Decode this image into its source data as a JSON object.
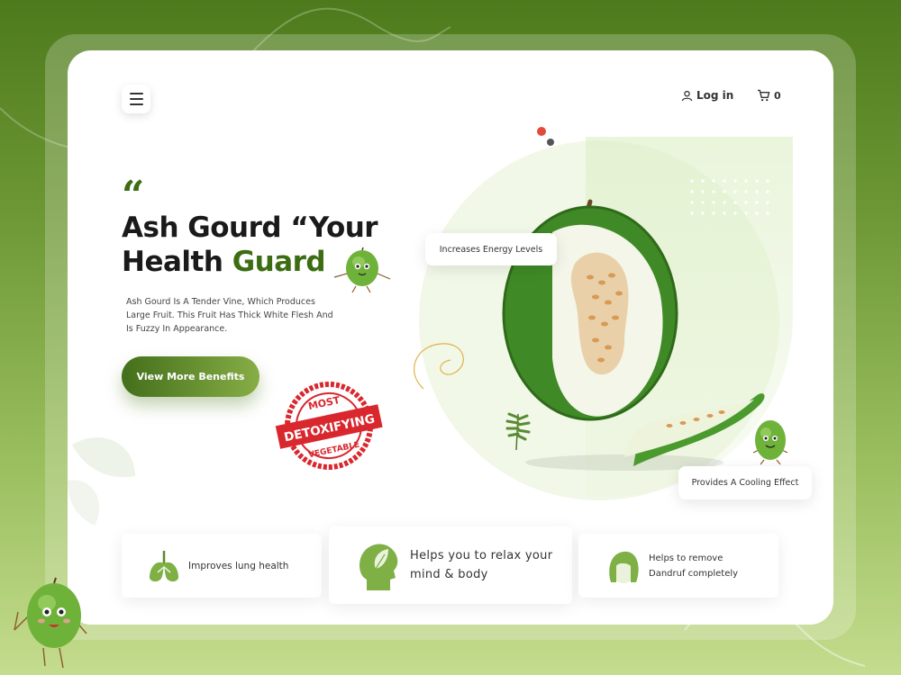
{
  "header": {
    "menu_icon": "hamburger-menu-icon",
    "login_label": "Log in",
    "login_icon": "user-icon",
    "cart_icon": "cart-icon",
    "cart_count": "0"
  },
  "hero": {
    "quote_mark": "“",
    "title_line1": "Ash Gourd “Your",
    "title_line2_plain": "Health ",
    "title_line2_accent": "Guard",
    "description": "Ash Gourd Is A Tender Vine, Which Produces Large Fruit. This Fruit Has Thick White Flesh And Is Fuzzy In Appearance.",
    "cta_label": "View More Benefits",
    "stamp": {
      "top": "MOST",
      "middle": "DETOXIFYING",
      "bottom": "VEGETABLE"
    }
  },
  "tags": {
    "energy": "Increases Energy Levels",
    "cooling": "Provides A Cooling Effect"
  },
  "benefits": [
    {
      "icon": "lungs-icon",
      "label": "Improves lung health"
    },
    {
      "icon": "mind-leaf-icon",
      "label": "Helps you to relax your mind & body"
    },
    {
      "icon": "hair-head-icon",
      "label": "Helps to remove Dandruf completely"
    }
  ],
  "colors": {
    "accent": "#3d6d12",
    "button_start": "#446f1b",
    "button_end": "#86ad45",
    "stamp_red": "#d9272e",
    "dot_red": "#e24a3b"
  }
}
